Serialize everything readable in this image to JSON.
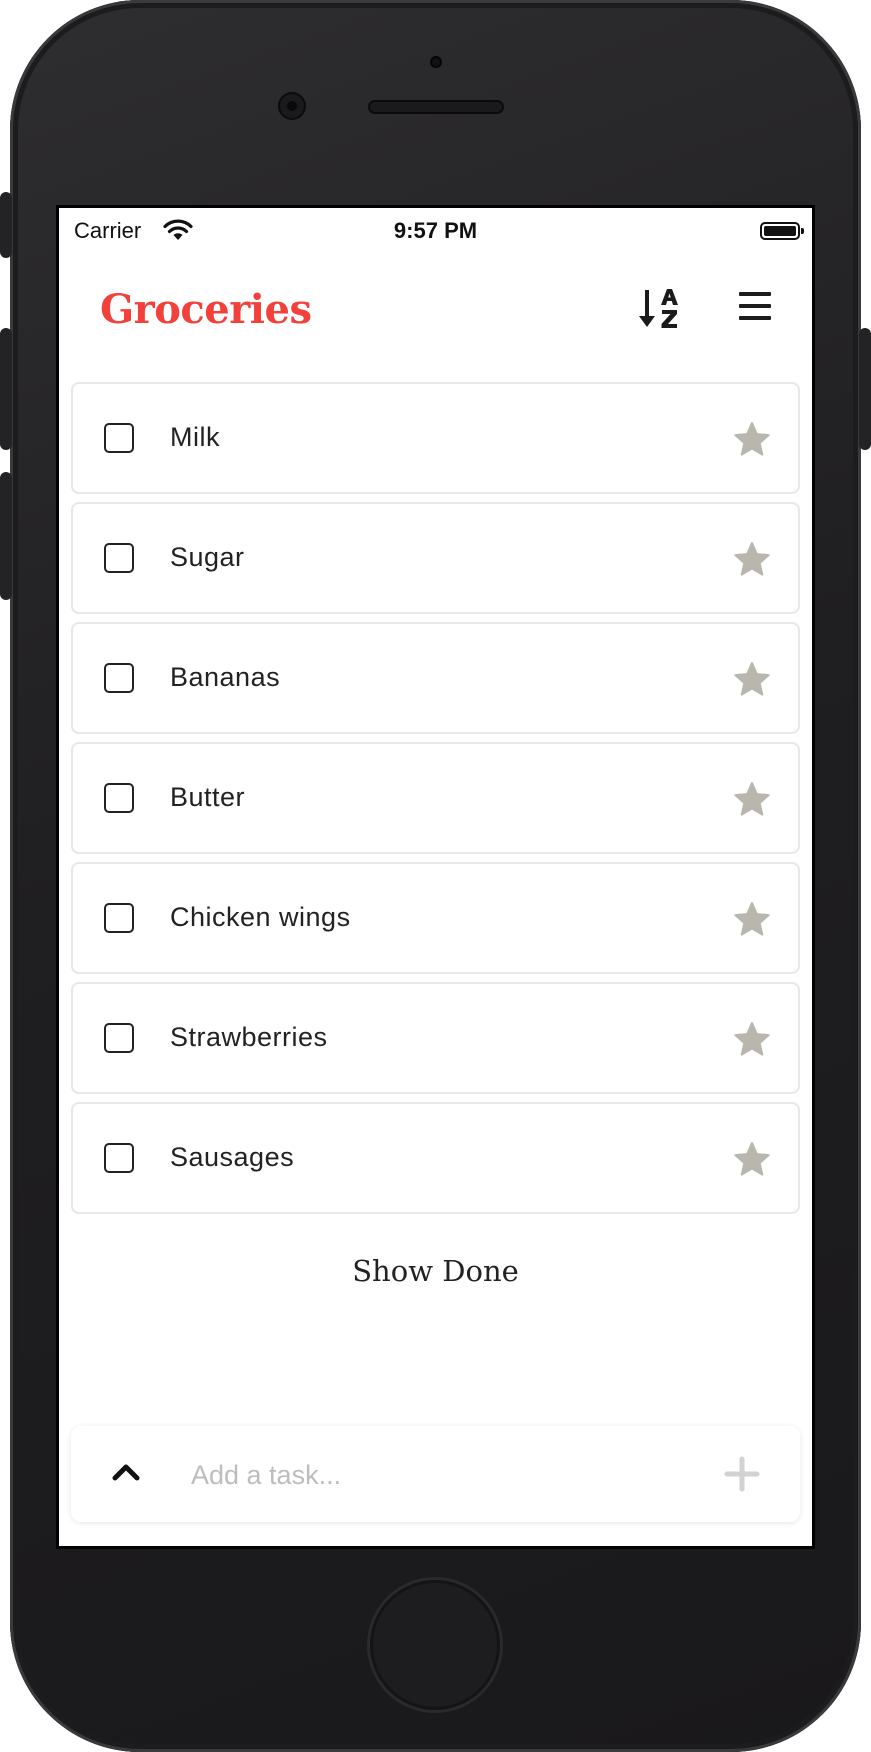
{
  "status_bar": {
    "carrier": "Carrier",
    "time": "9:57 PM"
  },
  "header": {
    "title": "Groceries",
    "sort_icon": "sort-alpha-down-icon",
    "menu_icon": "hamburger-menu-icon"
  },
  "tasks": [
    {
      "label": "Milk",
      "checked": false,
      "starred": false
    },
    {
      "label": "Sugar",
      "checked": false,
      "starred": false
    },
    {
      "label": "Bananas",
      "checked": false,
      "starred": false
    },
    {
      "label": "Butter",
      "checked": false,
      "starred": false
    },
    {
      "label": "Chicken wings",
      "checked": false,
      "starred": false
    },
    {
      "label": "Strawberries",
      "checked": false,
      "starred": false
    },
    {
      "label": "Sausages",
      "checked": false,
      "starred": false
    }
  ],
  "show_done_label": "Show Done",
  "add_task": {
    "placeholder": "Add a task...",
    "value": ""
  },
  "colors": {
    "accent": "#f1413a",
    "star_inactive": "#b9b6ae",
    "text": "#222222"
  }
}
